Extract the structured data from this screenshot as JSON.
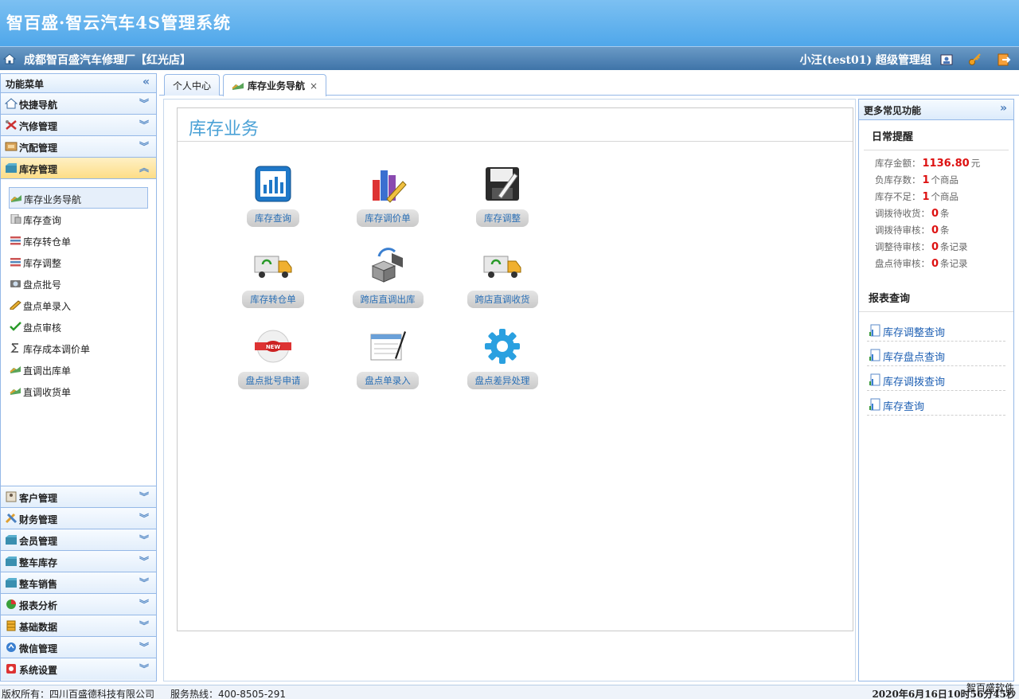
{
  "app": {
    "title": "智百盛·智云汽车4S管理系统"
  },
  "header": {
    "store": "成都智百盛汽车修理厂【红光店】",
    "user": "小汪(test01) 超级管理组"
  },
  "sidebar": {
    "title": "功能菜单",
    "collapse_glyph": "«",
    "chevron_glyph": "︾",
    "chevron_up_glyph": "︽",
    "top_groups": [
      {
        "label": "快捷导航",
        "icon": "home-icon"
      },
      {
        "label": "汽修管理",
        "icon": "tools-icon"
      },
      {
        "label": "汽配管理",
        "icon": "parts-icon"
      },
      {
        "label": "库存管理",
        "icon": "warehouse-icon"
      }
    ],
    "sub_items": [
      {
        "label": "库存业务导航",
        "icon": "handshake-icon"
      },
      {
        "label": "库存查询",
        "icon": "doc-icon"
      },
      {
        "label": "库存转仓单",
        "icon": "list-icon"
      },
      {
        "label": "库存调整",
        "icon": "list-icon"
      },
      {
        "label": "盘点批号",
        "icon": "camera-icon"
      },
      {
        "label": "盘点单录入",
        "icon": "pencil-icon"
      },
      {
        "label": "盘点审核",
        "icon": "check-icon"
      },
      {
        "label": "库存成本调价单",
        "icon": "sigma-icon"
      },
      {
        "label": "直调出库单",
        "icon": "handshake-icon"
      },
      {
        "label": "直调收货单",
        "icon": "handshake-icon"
      }
    ],
    "bottom_groups": [
      {
        "label": "客户管理",
        "icon": "contact-icon"
      },
      {
        "label": "财务管理",
        "icon": "finance-icon"
      },
      {
        "label": "会员管理",
        "icon": "member-icon"
      },
      {
        "label": "整车库存",
        "icon": "car-stock-icon"
      },
      {
        "label": "整车销售",
        "icon": "car-sale-icon"
      },
      {
        "label": "报表分析",
        "icon": "pie-icon"
      },
      {
        "label": "基础数据",
        "icon": "database-icon"
      },
      {
        "label": "微信管理",
        "icon": "wechat-icon"
      },
      {
        "label": "系统设置",
        "icon": "settings-icon"
      }
    ]
  },
  "tabs": [
    {
      "label": "个人中心"
    },
    {
      "label": "库存业务导航",
      "close": "×"
    }
  ],
  "main": {
    "title": "库存业务",
    "tiles": [
      {
        "label": "库存查询",
        "icon": "chart-icon"
      },
      {
        "label": "库存调价单",
        "icon": "price-adjust-icon"
      },
      {
        "label": "库存调整",
        "icon": "floppy-icon"
      },
      {
        "label": "库存转仓单",
        "icon": "truck-icon"
      },
      {
        "label": "跨店直调出库",
        "icon": "transfer-out-icon"
      },
      {
        "label": "跨店直调收货",
        "icon": "truck-icon"
      },
      {
        "label": "盘点批号申请",
        "icon": "new-badge-icon"
      },
      {
        "label": "盘点单录入",
        "icon": "form-pen-icon"
      },
      {
        "label": "盘点差异处理",
        "icon": "gear-icon"
      }
    ]
  },
  "right_panel": {
    "title": "更多常见功能",
    "expand_glyph": "»",
    "daily_title": "日常提醒",
    "reminders": [
      {
        "label": "库存金额：",
        "value": "1136.80",
        "unit": "元"
      },
      {
        "label": "负库存数：",
        "value": "1",
        "unit": "个商品"
      },
      {
        "label": "库存不足：",
        "value": "1",
        "unit": "个商品"
      },
      {
        "label": "调拨待收货：",
        "value": "0",
        "unit": "条"
      },
      {
        "label": "调拨待审核：",
        "value": "0",
        "unit": "条"
      },
      {
        "label": "调整待审核：",
        "value": "0",
        "unit": "条记录"
      },
      {
        "label": "盘点待审核：",
        "value": "0",
        "unit": "条记录"
      }
    ],
    "report_title": "报表查询",
    "reports": [
      {
        "label": "库存调整查询"
      },
      {
        "label": "库存盘点查询"
      },
      {
        "label": "库存调拨查询"
      },
      {
        "label": "库存查询"
      }
    ]
  },
  "footer": {
    "copyright": "版权所有：四川百盛德科技有限公司",
    "hotline": "服务热线：400-8505-291",
    "brand": "智百盛软件",
    "datetime": "2020年6月16日10时56分45秒"
  }
}
